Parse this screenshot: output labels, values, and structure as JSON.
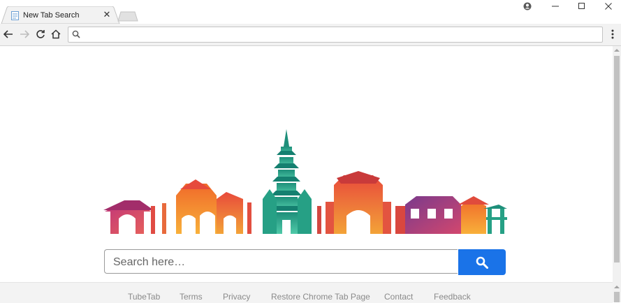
{
  "browser": {
    "tab_title": "New Tab Search",
    "tab_close_glyph": "✕",
    "address_value": "",
    "favicon": "page-icon",
    "window_controls": [
      "minimize",
      "maximize",
      "close"
    ]
  },
  "search": {
    "placeholder": "Search here…",
    "button_icon": "search-icon",
    "button_color": "#1a73e8"
  },
  "hero": {
    "illustration": "colorful city skyline with pagodas and gates"
  },
  "footer": {
    "links": [
      {
        "label": "TubeTab"
      },
      {
        "label": "Terms"
      },
      {
        "label": "Privacy"
      },
      {
        "label": "Restore Chrome Tab Page"
      },
      {
        "label": "Contact"
      },
      {
        "label": "Feedback"
      }
    ]
  }
}
